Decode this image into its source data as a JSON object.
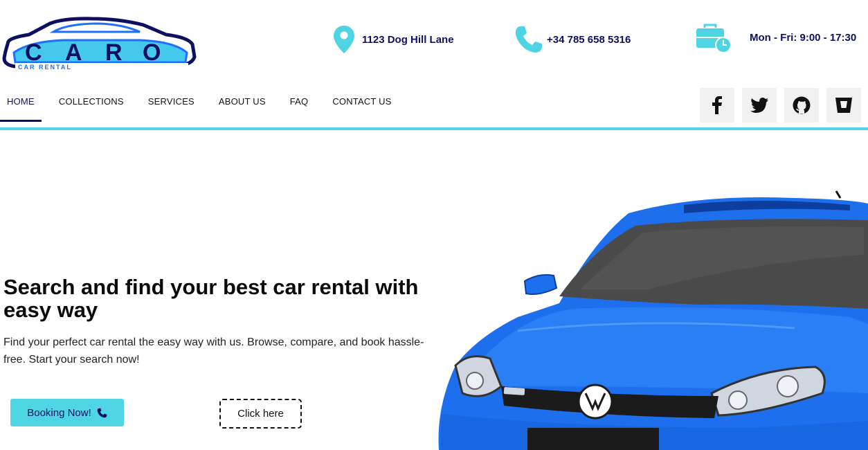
{
  "brand": {
    "logo_text": "CARO",
    "logo_subtext": "CAR RENTAL",
    "colors": {
      "primary": "#0d1060",
      "accent": "#4fd4e4",
      "logo_blue": "#1e6fff"
    }
  },
  "contact": {
    "address": {
      "icon": "map-pin-icon",
      "text": "1123 Dog Hill Lane"
    },
    "phone": {
      "icon": "phone-icon",
      "text": "+34 785 658 5316"
    },
    "hours": {
      "icon": "briefcase-clock-icon",
      "text": "Mon - Fri: 9:00 - 17:30"
    }
  },
  "nav": {
    "items": [
      {
        "label": "HOME",
        "active": true
      },
      {
        "label": "COLLECTIONS"
      },
      {
        "label": "SERVICES"
      },
      {
        "label": "ABOUT US"
      },
      {
        "label": "FAQ"
      },
      {
        "label": "CONTACT US"
      }
    ],
    "socials": [
      "facebook-icon",
      "twitter-icon",
      "github-icon",
      "bitbucket-icon"
    ]
  },
  "hero": {
    "title": "Search and find your best car rental with easy way",
    "text": "Find your perfect car rental the easy way with us. Browse, compare, and book hassle-free. Start your search now!",
    "primary_button": "Booking Now!",
    "secondary_button": "Click here"
  }
}
